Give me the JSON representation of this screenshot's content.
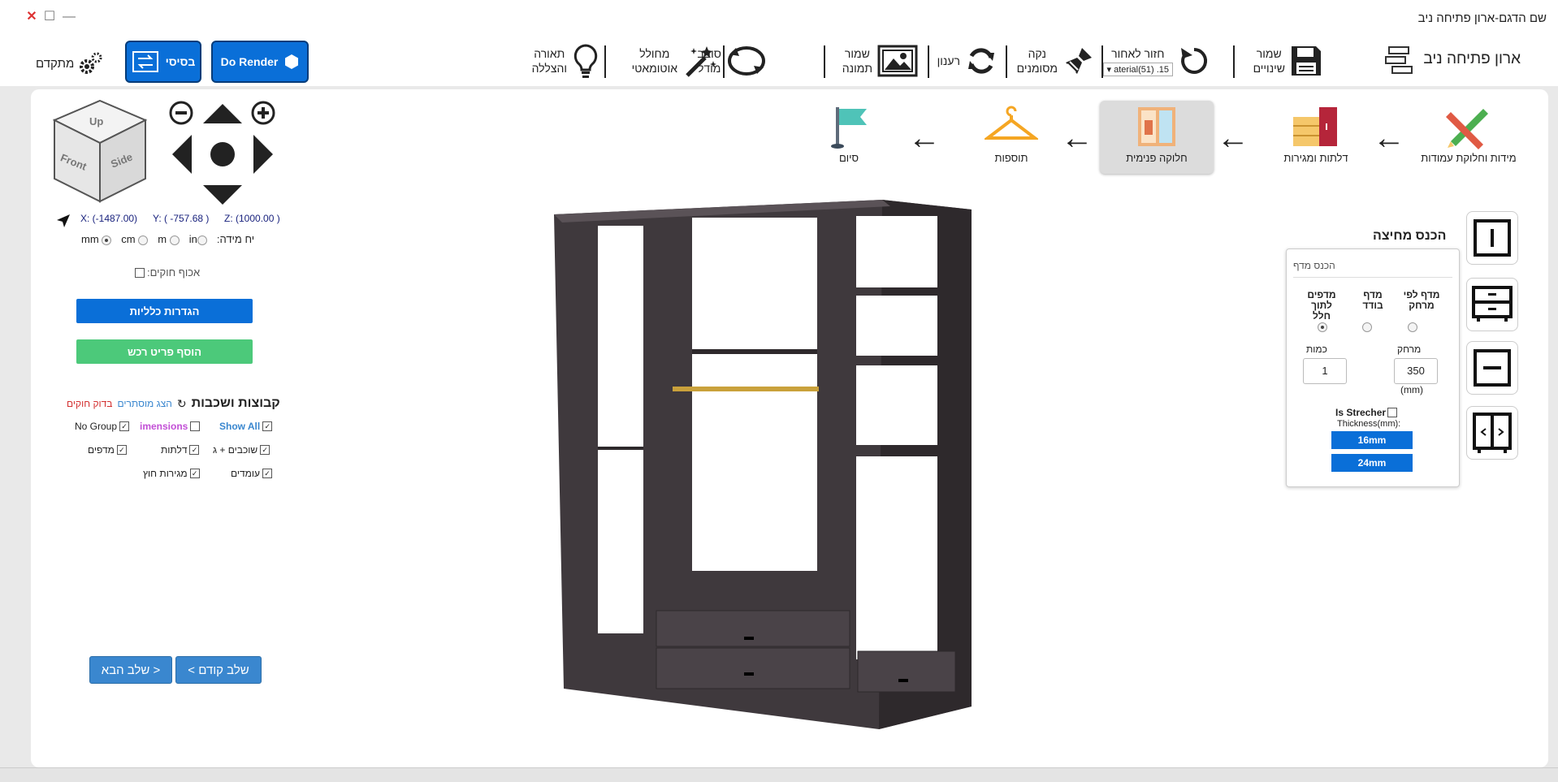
{
  "window": {
    "title": "שם הדגם-ארון פתיחה ניב"
  },
  "toolbar": {
    "model_name": "ארון פתיחה ניב",
    "save_label": "שמור\nשינויים",
    "undo_label": "חזור לאחור",
    "material_select": "aterial(51) .15",
    "clean_label": "נקה\nמסומנים",
    "refresh_label": "רענון",
    "save_image_label": "שמור\nתמונה",
    "rotate_label": "סובב\nמודל",
    "auto_generate_label": "מחולל\nאוטומאטי",
    "lighting_label": "תאורה\nוהצללה",
    "render_label": "Do Render",
    "basic_label": "בסיסי",
    "advanced_label": "מתקדם"
  },
  "steps": [
    {
      "label": "מידות וחלוקת עמודות"
    },
    {
      "label": "דלתות ומגירות"
    },
    {
      "label": "חלוקה פנימית"
    },
    {
      "label": "תוספות"
    },
    {
      "label": "סיום"
    }
  ],
  "view_cube": {
    "up": "Up",
    "front": "Front",
    "side": "Side"
  },
  "coords": {
    "x": "X: (-1487.00)",
    "y": "Y: ( -757.68 )",
    "z": "Z: (1000.00 )"
  },
  "units": {
    "label": "יח מידה:",
    "options": [
      "in",
      "m",
      "cm",
      "mm"
    ],
    "selected": "mm"
  },
  "sidebar": {
    "force_hinges": "אכוף חוקים:",
    "general_settings": "הגדרות כלליות",
    "add_price_label": "הוסף פריט רכש",
    "layers_title": "קבוצות ושכבות",
    "show_hidden": "הצג מוסתרים",
    "check_hinges": "בדוק חוקים",
    "checks": [
      {
        "label": "Show All",
        "checked": true
      },
      {
        "label": "imensions",
        "checked": false
      },
      {
        "label": "No Group",
        "checked": true
      },
      {
        "label": "שוכבים + ג",
        "checked": true
      },
      {
        "label": "דלתות",
        "checked": true
      },
      {
        "label": "מדפים",
        "checked": true
      },
      {
        "label": "עומדים",
        "checked": true
      },
      {
        "label": "מגירות חוץ",
        "checked": true
      }
    ],
    "next_step": "שלב הבא >",
    "prev_step": "< שלב קודם"
  },
  "panel": {
    "section_title": "הכנס מחיצה",
    "header": "הכנס מדף",
    "options": [
      "מדף לפי\nמרחק",
      "מדף\nבודד",
      "מדפים\nלתוך חלל"
    ],
    "selected_option": 2,
    "distance_label": "מרחק",
    "distance_value": "350",
    "count_label": "כמות",
    "count_value": "1",
    "unit_note": "(mm)",
    "stretcher_label": "Is Strecher",
    "thickness_label": "Thickness(mm):",
    "thickness_options": [
      "16mm",
      "24mm"
    ]
  },
  "colors": {
    "accent": "#0a6fd8",
    "green": "#4cc97a",
    "nav": "#3a87cf",
    "wardrobe": "#4a4348"
  }
}
